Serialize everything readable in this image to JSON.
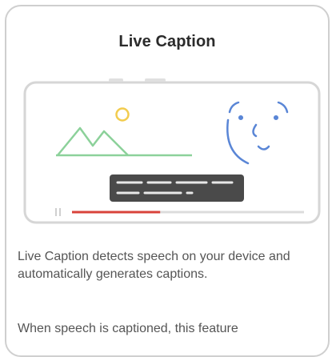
{
  "dialog": {
    "title": "Live Caption",
    "description": "Live Caption detects speech on your device and automatically generates captions.",
    "description_2": "When speech is captioned, this feature"
  },
  "illustration": {
    "progress": 0.38,
    "colors": {
      "mountains": "#8cd19a",
      "sun": "#f2cc4e",
      "face": "#5a86d6",
      "caption_box": "#4a4a4a",
      "caption_lines": "#e8e8e8",
      "progress_played": "#d9433b",
      "progress_track": "#dcdcdc",
      "frame": "#d6d6d6"
    }
  }
}
